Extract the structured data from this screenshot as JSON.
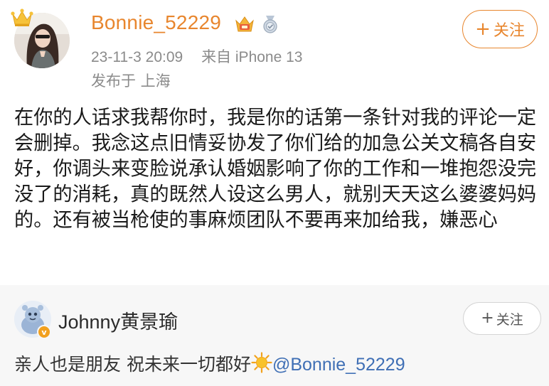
{
  "post": {
    "username": "Bonnie_52229",
    "date": "23-11-3 20:09",
    "source": "来自 iPhone 13",
    "location": "发布于 上海",
    "follow_plus": "+",
    "follow_label": "关注",
    "content": "在你的人话求我帮你时，我是你的话第一条针对我的评论一定会删掉。我念这点旧情妥协发了你们给的加急公关文稿各自安好，你调头来变脸说承认婚姻影响了你的工作和一堆抱怨没完没了的消耗，真的既然人设这么男人，就别天天这么婆婆妈妈的。还有被当枪使的事麻烦团队不要再来加给我，嫌恶心",
    "icons": [
      "crown-icon",
      "vip-badge-icon",
      "medal-badge-icon"
    ]
  },
  "reply": {
    "username": "Johnny黄景瑜",
    "verified_mark": "v",
    "follow_plus": "+",
    "follow_label": "关注",
    "text": "亲人也是朋友 祝未来一切都好",
    "emoji": "sun-emoji-icon",
    "mention": "@Bonnie_52229"
  },
  "colors": {
    "accent": "#e8862e",
    "mention": "#3f6fb5",
    "meta": "#8b8b8b",
    "reply_bg": "#f7f7f7"
  }
}
